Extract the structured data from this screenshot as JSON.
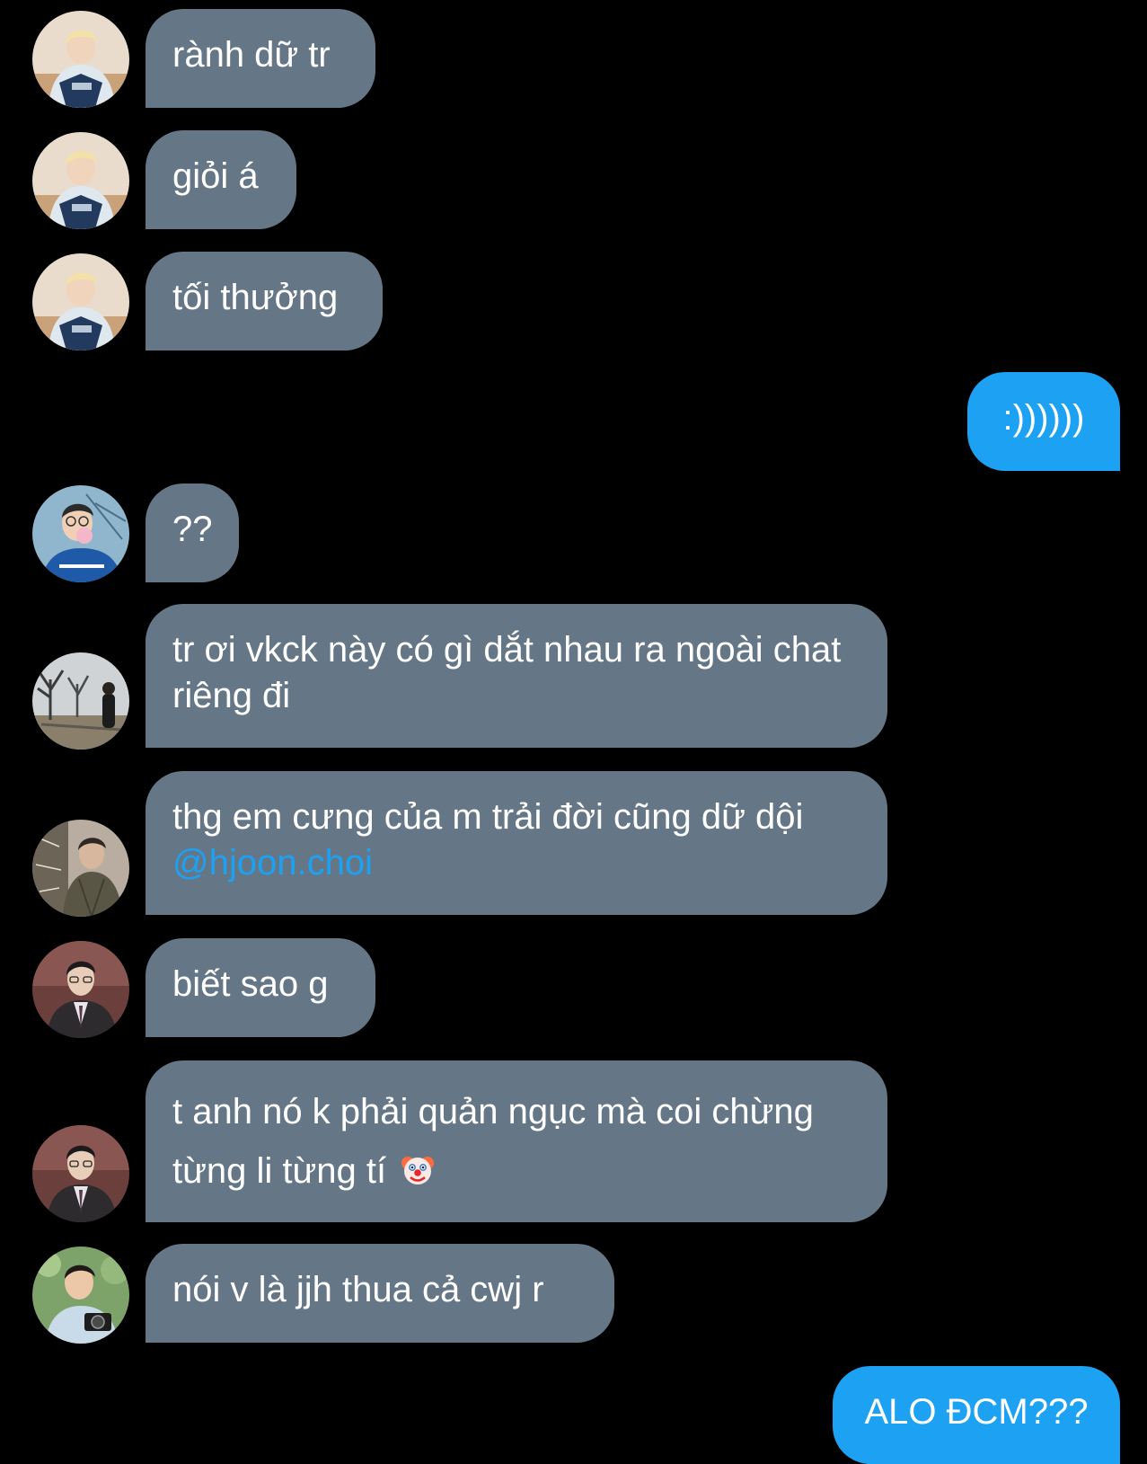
{
  "conversation": {
    "messages": [
      {
        "sender": "other",
        "avatar": "avatar-blond-hoodie",
        "text": "rành dữ tr"
      },
      {
        "sender": "other",
        "avatar": "avatar-blond-hoodie",
        "text": "giỏi á"
      },
      {
        "sender": "other",
        "avatar": "avatar-blond-hoodie",
        "text": "tối thưởng"
      },
      {
        "sender": "me",
        "text": ":))))))"
      },
      {
        "sender": "other",
        "avatar": "avatar-bubblegum-glasses",
        "text": "??"
      },
      {
        "sender": "other",
        "avatar": "avatar-park-trees",
        "text": "tr ơi vkck này có gì dắt nhau ra ngoài chat riêng đi"
      },
      {
        "sender": "other",
        "avatar": "avatar-denim-jacket",
        "text": "thg em cưng của m trải đời cũng dữ dội ",
        "mention": "@hjoon.choi"
      },
      {
        "sender": "other",
        "avatar": "avatar-suit-glasses",
        "text": "biết sao g"
      },
      {
        "sender": "other",
        "avatar": "avatar-suit-glasses",
        "text": "t anh nó k phải quản ngục mà coi chừng từng li từng tí",
        "emoji": "clown-face-emoji"
      },
      {
        "sender": "other",
        "avatar": "avatar-camera-man",
        "text": "nói v là jjh thua cả cwj r"
      },
      {
        "sender": "me",
        "text": "ALO ĐCM???"
      }
    ]
  },
  "colors": {
    "background": "#000000",
    "incoming_bubble": "#657786",
    "outgoing_bubble": "#1da1f2",
    "mention": "#1da1f2",
    "text": "#ffffff"
  }
}
